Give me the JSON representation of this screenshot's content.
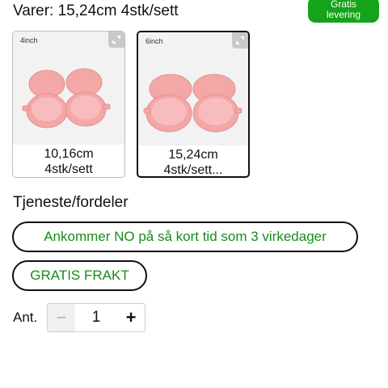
{
  "header": {
    "variant_line": "Varer: 15,24cm 4stk/sett",
    "badge": {
      "line1": "Gratis",
      "line2": "levering",
      "color": "#14a319"
    }
  },
  "variants": [
    {
      "size_tag": "4inch",
      "line1": "10,16cm",
      "line2": "4stk/sett",
      "selected": false,
      "expand_icon": "expand-icon"
    },
    {
      "size_tag": "6inch",
      "line1": "15,24cm",
      "line2": "4stk/sett...",
      "selected": true,
      "expand_icon": "expand-icon"
    }
  ],
  "services": {
    "title": "Tjeneste/fordeler",
    "items": [
      {
        "label": "Ankommer NO på så kort tid som 3 virkedager"
      },
      {
        "label": "GRATIS FRAKT"
      }
    ],
    "text_color": "#178c1a"
  },
  "quantity": {
    "label": "Ant.",
    "value": "1",
    "minus_glyph": "−",
    "plus_glyph": "+"
  },
  "colors": {
    "pan_fill": "#f3a7a6",
    "pan_shade": "#e8908f"
  }
}
